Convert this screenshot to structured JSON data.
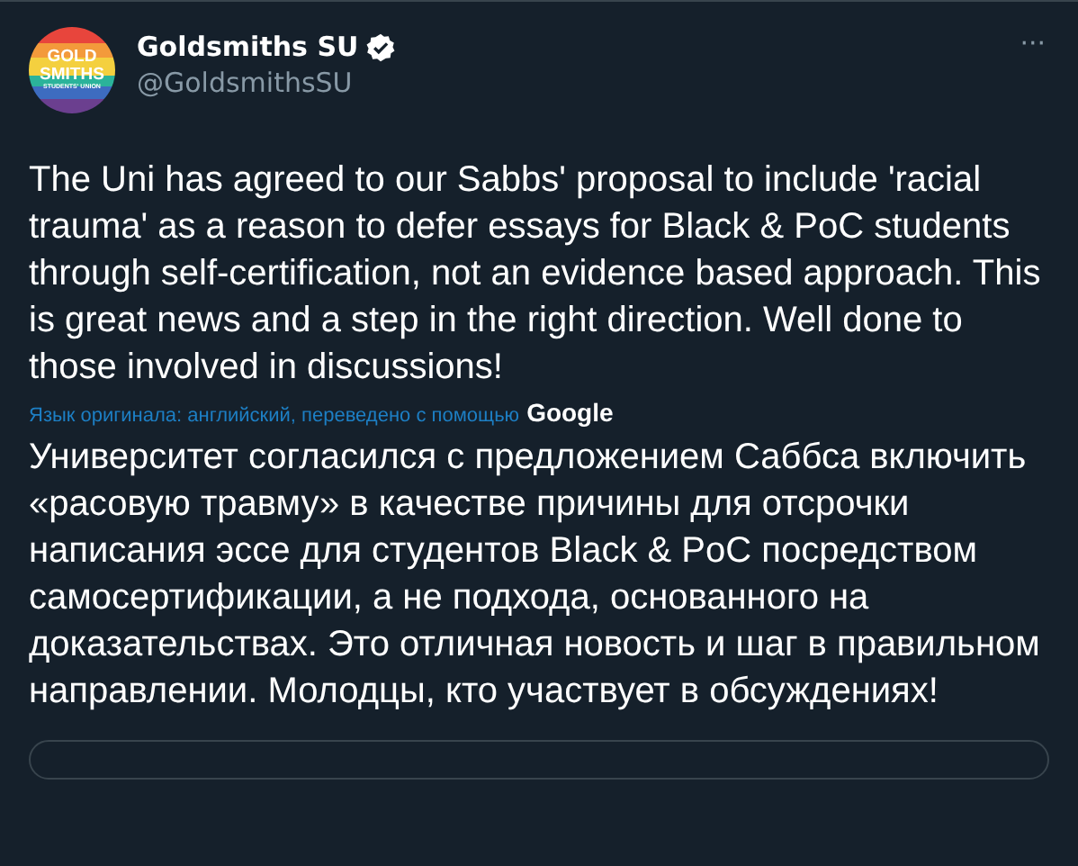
{
  "tweet": {
    "avatar": {
      "line_1": "GOLD",
      "line_2": "SMITHS",
      "line_3": "STUDENTS' UNION"
    },
    "author": {
      "name": "Goldsmiths SU",
      "verified": true,
      "handle": "@GoldsmithsSU"
    },
    "more_button": "···",
    "text": "The Uni has agreed to our Sabbs' proposal to include 'racial trauma' as a reason to defer essays for Black & PoC students through self-certification, not an evidence based approach. This is great news and a step in the right direction. Well done to those involved in discussions!",
    "translation_note": "Язык оригинала: английский, переведено с помощью",
    "translation_provider": "Google",
    "translated_text": "Университет согласился с предложением Саббса включить «расовую травму» в качестве причины для отсрочки написания эссе для студентов Black & PoC посредством самосертификации, а не подхода, основанного на доказательствах. Это отличная новость и шаг в правильном направлении. Молодцы, кто участвует в обсуждениях!"
  }
}
